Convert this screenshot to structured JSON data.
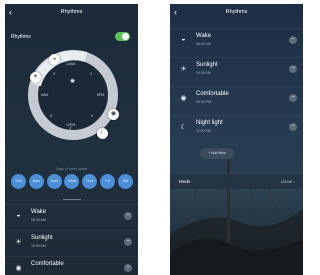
{
  "left_screen": {
    "header": {
      "back_icon": "chevron-left-icon",
      "title": "Rhythms"
    },
    "rhythms_toggle": {
      "label": "Rhythms",
      "enabled": true,
      "color": "#5cc15e"
    },
    "dial": {
      "ticks": [
        "12AM",
        "9",
        "3",
        "6AM",
        "6PM",
        "6",
        "9",
        "12PM"
      ],
      "center_icon": "bulb-icon",
      "bottom_icon": "moon-icon"
    },
    "days_caption": "Days of week active",
    "days": [
      "Sun",
      "Mon",
      "Tues",
      "Wed",
      "Thur",
      "Fri",
      "Sat"
    ],
    "items": [
      {
        "icon": "sunrise-icon",
        "name": "Wake",
        "time": "06:30 AM",
        "minus": "−"
      },
      {
        "icon": "sun-icon",
        "name": "Sunlight",
        "time": "10:30 AM",
        "minus": "−"
      },
      {
        "icon": "comfort-icon",
        "name": "Comfortable",
        "time": "",
        "minus": "−"
      }
    ],
    "accent": "#4c8fd6"
  },
  "right_screen": {
    "header": {
      "back_icon": "chevron-left-icon",
      "title": "Rhythms"
    },
    "items": [
      {
        "icon": "sunrise-icon",
        "name": "Wake",
        "time": "06:30 AM",
        "minus": "−"
      },
      {
        "icon": "sun-icon",
        "name": "Sunlight",
        "time": "10:30 AM",
        "minus": "−"
      },
      {
        "icon": "comfort-icon",
        "name": "Comfortable",
        "time": "06:00 PM",
        "minus": "−"
      },
      {
        "icon": "moon-icon",
        "name": "Night light",
        "time": "11:00 PM",
        "minus": "−"
      }
    ],
    "add_new": "+ Add New",
    "mode": {
      "label": "Mode",
      "value": "Linear ›"
    }
  }
}
